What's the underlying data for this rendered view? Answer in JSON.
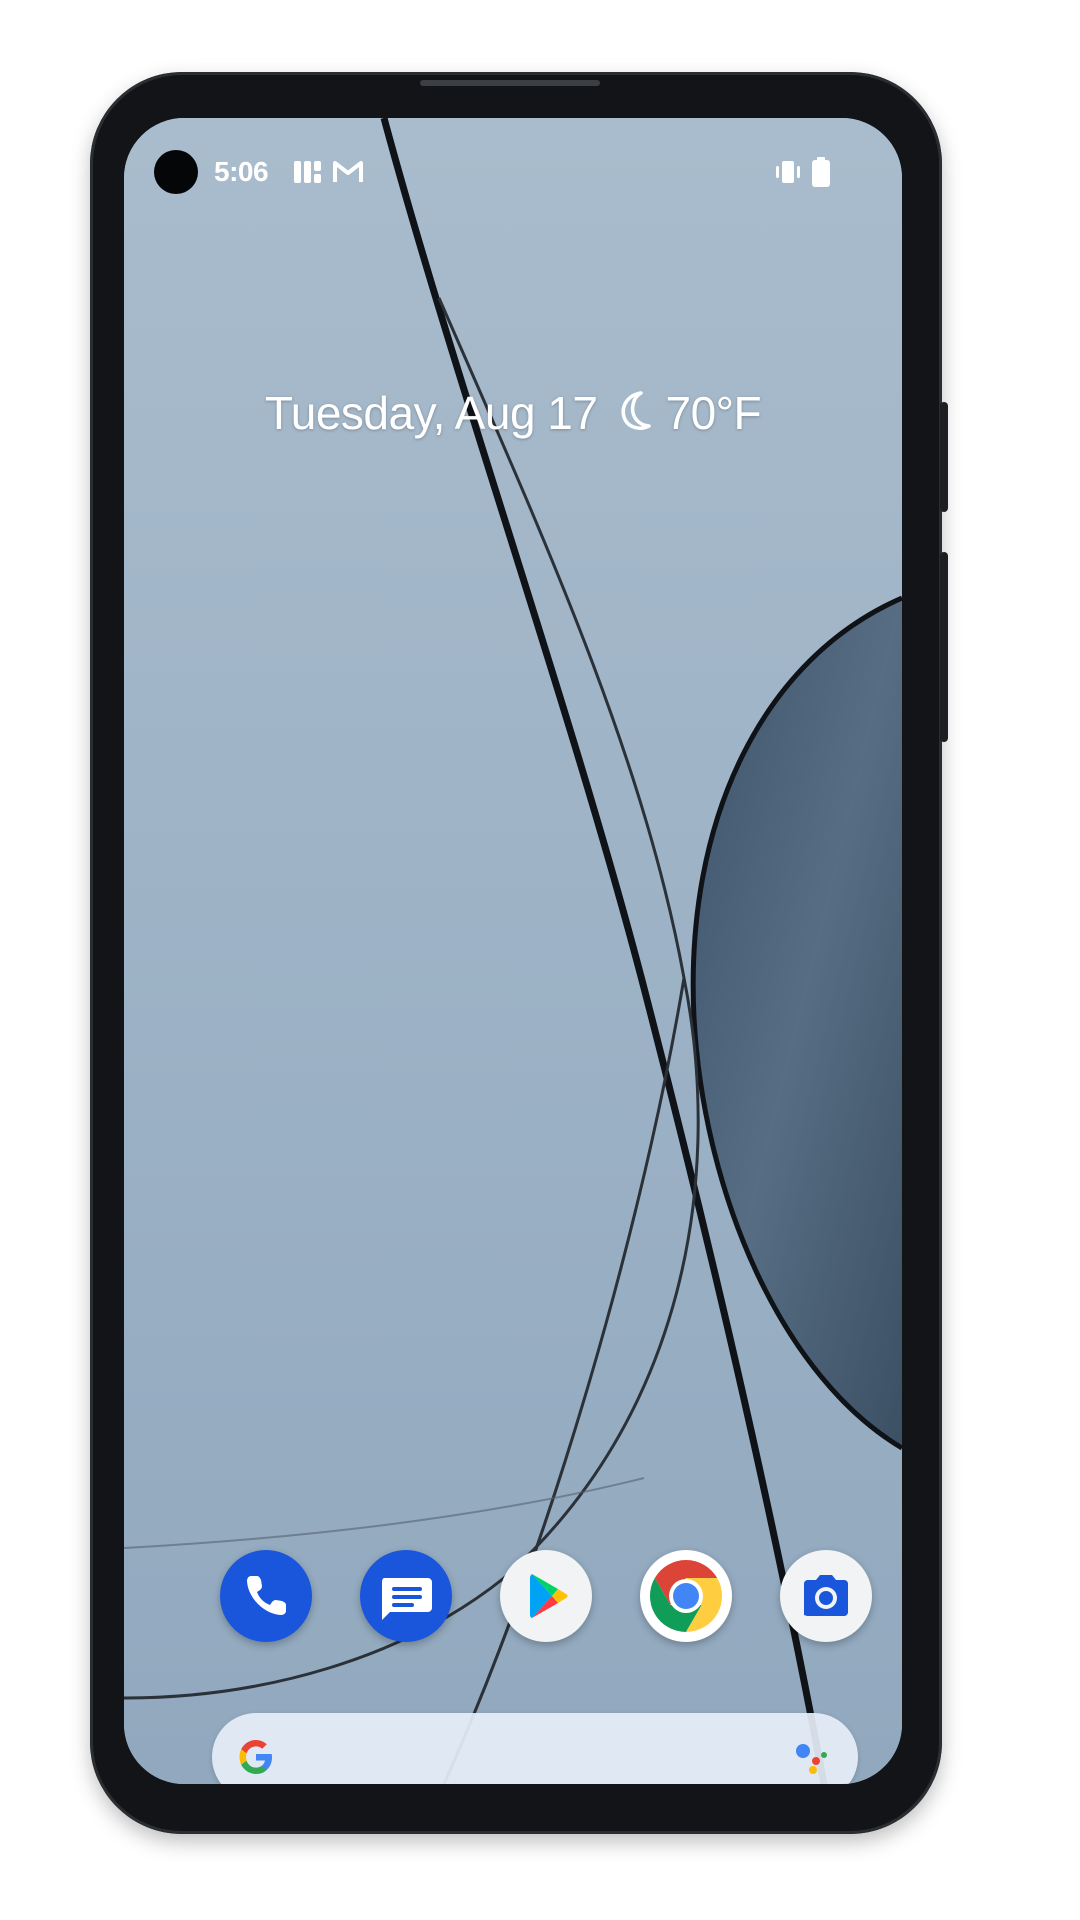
{
  "status_bar": {
    "time": "5:06",
    "notification_icons": [
      "fitbit-icon",
      "gmail-icon"
    ],
    "right_icons": [
      "vibrate-icon",
      "battery-icon"
    ]
  },
  "glance": {
    "date": "Tuesday, Aug 17",
    "weather_icon": "moon-icon",
    "temperature": "70°F"
  },
  "dock": {
    "apps": [
      {
        "name": "Phone",
        "icon": "phone-icon",
        "color": "#1a56db"
      },
      {
        "name": "Messages",
        "icon": "messages-icon",
        "color": "#1a56db"
      },
      {
        "name": "Play Store",
        "icon": "play-store-icon",
        "color": "#f1f3f4"
      },
      {
        "name": "Chrome",
        "icon": "chrome-icon",
        "color": "#ffffff"
      },
      {
        "name": "Camera",
        "icon": "camera-icon",
        "color": "#f1f3f4"
      }
    ]
  },
  "search_bar": {
    "logo": "google-g-icon",
    "assistant": "google-assistant-icon"
  },
  "colors": {
    "wallpaper": "#9fb3c6",
    "dark_shape": "#4d6277",
    "frame": "#121417"
  }
}
